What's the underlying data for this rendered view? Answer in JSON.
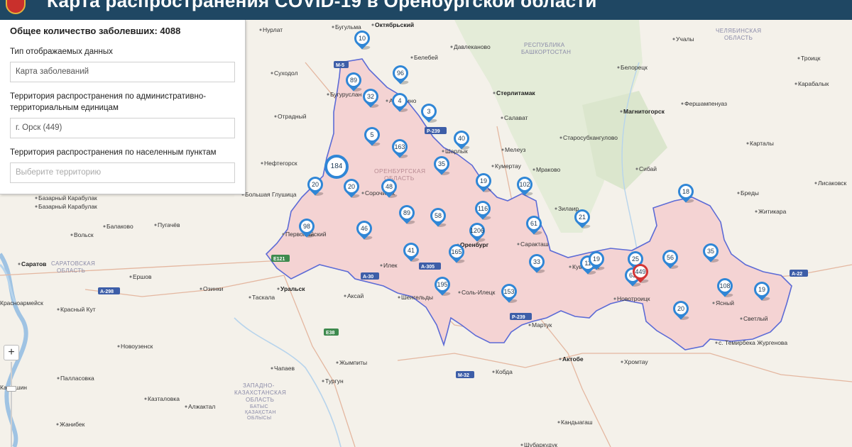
{
  "header": {
    "title": "Карта распространения COVID-19 в Оренбургской области",
    "colors": {
      "bar": "#1f4763",
      "crest": "#c9302c"
    }
  },
  "panel": {
    "total_label": "Общее количество заболевших: 4088",
    "data_type_label": "Тип отображаемых данных",
    "data_type_value": "Карта заболеваний",
    "admin_label": "Территория распространения по административно-территориальным единицам",
    "admin_value": "г. Орск (449)",
    "settlement_label": "Территория распространения по населенным пунктам",
    "settlement_placeholder": "Выберите территорию"
  },
  "map": {
    "colors": {
      "region_fill": "#f4d3d3",
      "region_border": "#5c6bd6",
      "marker": "#2f86d6",
      "marker_active": "#d23535",
      "forest": "#dfe8d2"
    },
    "zoom_plus_label": "+",
    "region_labels": {
      "orenburg": [
        "ОРЕНБУРГСКАЯ",
        "ОБЛАСТЬ"
      ],
      "bashkortostan": [
        "РЕСПУБЛИКА",
        "БАШКОРТОСТАН"
      ],
      "chelyabinsk": [
        "ЧЕЛЯБИНСКАЯ",
        "ОБЛАСТЬ"
      ],
      "saratov": [
        "САРАТОВСКАЯ",
        "ОБЛАСТЬ"
      ],
      "west_kz": [
        "ЗАПАДНО-",
        "КАЗАХСТАНСКАЯ",
        "ОБЛАСТЬ"
      ],
      "west_kz_kaz": [
        "БАТЫС",
        "ҚАЗАҚСТАН",
        "ОБЛЫСЫ"
      ]
    },
    "cities": [
      {
        "name": "Октябрьский",
        "bold": true
      },
      {
        "name": "Бугульма"
      },
      {
        "name": "Нурлат"
      },
      {
        "name": "Белебей"
      },
      {
        "name": "Давлеканово"
      },
      {
        "name": "Учалы"
      },
      {
        "name": "Суходол"
      },
      {
        "name": "Бугуруслан"
      },
      {
        "name": "Абдулино"
      },
      {
        "name": "Стерлитамак",
        "bold": true
      },
      {
        "name": "Белорецк"
      },
      {
        "name": "Троицк"
      },
      {
        "name": "Карабалык"
      },
      {
        "name": "Отрадный"
      },
      {
        "name": "Салават"
      },
      {
        "name": "Магнитогорск",
        "bold": true
      },
      {
        "name": "Фершампенуаз"
      },
      {
        "name": "Кумертау"
      },
      {
        "name": "Старосубхангулово"
      },
      {
        "name": "Шарлык"
      },
      {
        "name": "Мелеуз"
      },
      {
        "name": "Нефтегорск"
      },
      {
        "name": "Мраково"
      },
      {
        "name": "Сибай"
      },
      {
        "name": "Карталы"
      },
      {
        "name": "Большая Глушица"
      },
      {
        "name": "Бреды"
      },
      {
        "name": "Лисаковск"
      },
      {
        "name": "Базарный Карабулак"
      },
      {
        "name": "Сорочинск"
      },
      {
        "name": "Зилаир"
      },
      {
        "name": "Житикара"
      },
      {
        "name": "Пугачёв"
      },
      {
        "name": "Балаково"
      },
      {
        "name": "Вольск"
      },
      {
        "name": "Бузулук"
      },
      {
        "name": "Первомайский"
      },
      {
        "name": "Оренбург",
        "bold": true
      },
      {
        "name": "Саракташ"
      },
      {
        "name": "Саратов",
        "bold": true
      },
      {
        "name": "Илек"
      },
      {
        "name": "Кувандык"
      },
      {
        "name": "Ершов"
      },
      {
        "name": "Уральск",
        "bold": true
      },
      {
        "name": "Аксай"
      },
      {
        "name": "Соль-Илецк"
      },
      {
        "name": "Новотроицк"
      },
      {
        "name": "Красноармейск"
      },
      {
        "name": "Озинки"
      },
      {
        "name": "Таскала"
      },
      {
        "name": "Шенгельды"
      },
      {
        "name": "Ясный"
      },
      {
        "name": "Светлый"
      },
      {
        "name": "Красный Кут"
      },
      {
        "name": "Мартук"
      },
      {
        "name": "Новоузенск"
      },
      {
        "name": "Актобе",
        "bold": true
      },
      {
        "name": "Хромтау"
      },
      {
        "name": "с. Темирбека Жургенова"
      },
      {
        "name": "Жымпиты"
      },
      {
        "name": "Кобда"
      },
      {
        "name": "Палласовка"
      },
      {
        "name": "Чапаев"
      },
      {
        "name": "Тургун"
      },
      {
        "name": "Казталовка"
      },
      {
        "name": "Алжактал"
      },
      {
        "name": "Жанибек"
      },
      {
        "name": "Кандыагаш"
      },
      {
        "name": "Шубаркудук"
      },
      {
        "name": "Камышин"
      },
      {
        "name": "Базарный Карабулак"
      }
    ],
    "road_labels": [
      "М-5",
      "Р-239",
      "Е121",
      "А-305",
      "А-30",
      "А-298",
      "Е38",
      "А-22",
      "М-32",
      "Р-239"
    ],
    "markers": [
      {
        "value": "10"
      },
      {
        "value": "89"
      },
      {
        "value": "96"
      },
      {
        "value": "32"
      },
      {
        "value": "4"
      },
      {
        "value": "3"
      },
      {
        "value": "5"
      },
      {
        "value": "163"
      },
      {
        "value": "40"
      },
      {
        "value": "184",
        "big": true
      },
      {
        "value": "35"
      },
      {
        "value": "20"
      },
      {
        "value": "20"
      },
      {
        "value": "48"
      },
      {
        "value": "19"
      },
      {
        "value": "102"
      },
      {
        "value": "18"
      },
      {
        "value": "98"
      },
      {
        "value": "46"
      },
      {
        "value": "89"
      },
      {
        "value": "58"
      },
      {
        "value": "116"
      },
      {
        "value": "1206"
      },
      {
        "value": "61"
      },
      {
        "value": "21"
      },
      {
        "value": "41"
      },
      {
        "value": "165"
      },
      {
        "value": "33"
      },
      {
        "value": "11"
      },
      {
        "value": "19"
      },
      {
        "value": "25"
      },
      {
        "value": "56"
      },
      {
        "value": "35"
      },
      {
        "value": "195"
      },
      {
        "value": "153"
      },
      {
        "value": "63"
      },
      {
        "value": "449",
        "active": true
      },
      {
        "value": "108"
      },
      {
        "value": "19"
      },
      {
        "value": "20"
      }
    ]
  }
}
